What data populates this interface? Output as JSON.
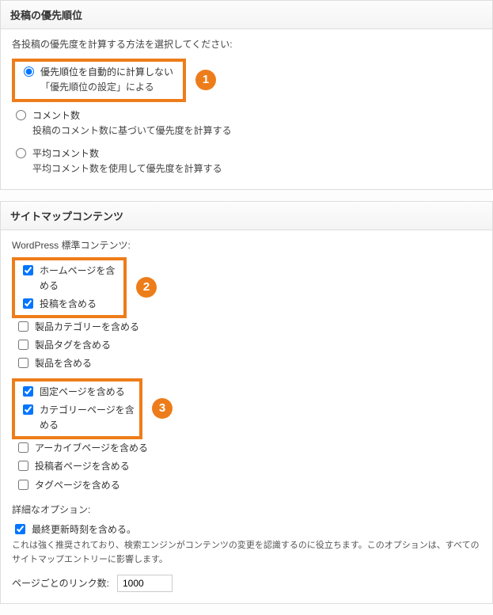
{
  "section1": {
    "title": "投稿の優先順位",
    "desc": "各投稿の優先度を計算する方法を選択してください:",
    "radios": [
      {
        "label": "優先順位を自動的に計算しない",
        "sub": "「優先順位の設定」による",
        "checked": true
      },
      {
        "label": "コメント数",
        "sub": "投稿のコメント数に基づいて優先度を計算する",
        "checked": false
      },
      {
        "label": "平均コメント数",
        "sub": "平均コメント数を使用して優先度を計算する",
        "checked": false
      }
    ],
    "badge": "1"
  },
  "section2": {
    "title": "サイトマップコンテンツ",
    "group1_label": "WordPress 標準コンテンツ:",
    "badge2": "2",
    "badge3": "3",
    "checks_a": [
      {
        "label": "ホームページを含める",
        "checked": true
      },
      {
        "label": "投稿を含める",
        "checked": true
      }
    ],
    "checks_mid": [
      {
        "label": "製品カテゴリーを含める",
        "checked": false
      },
      {
        "label": "製品タグを含める",
        "checked": false
      },
      {
        "label": "製品を含める",
        "checked": false
      }
    ],
    "checks_b": [
      {
        "label": "固定ページを含める",
        "checked": true
      },
      {
        "label": "カテゴリーページを含める",
        "checked": true
      }
    ],
    "checks_after": [
      {
        "label": "アーカイブページを含める",
        "checked": false
      },
      {
        "label": "投稿者ページを含める",
        "checked": false
      },
      {
        "label": "タグページを含める",
        "checked": false
      }
    ],
    "adv_label": "詳細なオプション:",
    "adv_check": {
      "label": "最終更新時刻を含める。",
      "checked": true
    },
    "adv_note": "これは強く推奨されており、検索エンジンがコンテンツの変更を認識するのに役立ちます。このオプションは、すべてのサイトマップエントリーに影響します。",
    "links_label": "ページごとのリンク数:",
    "links_value": "1000"
  }
}
